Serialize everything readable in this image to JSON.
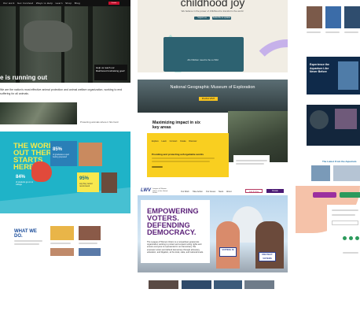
{
  "card_animal": {
    "nav_items": [
      "Our work",
      "Get Involved",
      "Ways to Help",
      "Learn",
      "Shop",
      "Blog"
    ],
    "donate_label": "Donate",
    "headline": "e is running out",
    "callout": "Help us reach our Rainforest fundraising goal!",
    "tagline": "We are the nation's most effective animal protection and animal welfare organization, working to end suffering for all animals.",
    "tagline_right": "Protecting animals where it hits hard"
  },
  "card_joy": {
    "title": "childhood joy",
    "subtitle": "We believe in the power of childhood to transform the world",
    "btn1": "Support us",
    "btn2": "Subscribe to updates",
    "panel_text": "All children need to be a child"
  },
  "card_museum": {
    "hero_title": "National Geographic Museum of Exploration",
    "hero_button": "PLAN A VISIT",
    "impact_title": "Maximizing impact in six key areas",
    "yellow_title": "Providing and protecting unforgettable worlds",
    "yellow_tabs": [
      "Explore",
      "Learn",
      "Connect",
      "Create",
      "Discover"
    ]
  },
  "card_world": {
    "title": "THE WORLD OUT THERE STARTS HERE",
    "stats": [
      "85%",
      "84%",
      "95%"
    ],
    "stat_captions": [
      "of graduates report feeling prepared",
      "of students go on to college",
      "say they would recommend"
    ]
  },
  "card_whatwedo": {
    "title": "WHAT WE DO."
  },
  "card_lwv": {
    "logo": "LWV",
    "logo_sub": "League of Women Voters of the United States",
    "nav": [
      "Our Work",
      "Take Action",
      "Our Issues",
      "News",
      "About"
    ],
    "join_label": "Join & Give",
    "donate_label": "Donate",
    "headline": "EMPOWERING VOTERS. DEFENDING DEMOCRACY.",
    "headline_lines": [
      "EMPOWERING",
      "VOTERS.",
      "DEFENDING",
      "DEMOCRACY."
    ],
    "paragraph": "The League of Women Voters is a nonpartisan grassroots organization working to protect and expand voting rights and ensure everyone is represented in our democracy. We empower voters and defend democracy through advocacy, education, and litigation, at the local, state, and national levels.",
    "sign1": "VOTING IS",
    "sign2": "PROTECT VOTERS"
  },
  "card_right_top": {
    "headline": "Experience the Aquarium Like Never Before",
    "latest_label": "The Latest From the Aquarium"
  },
  "colors": {
    "lwv_purple": "#5a1f78",
    "world_teal": "#1fb3c8",
    "world_yellow": "#f6e94a",
    "museum_yellow": "#f9cf20",
    "joy_teal": "#2d6271"
  }
}
